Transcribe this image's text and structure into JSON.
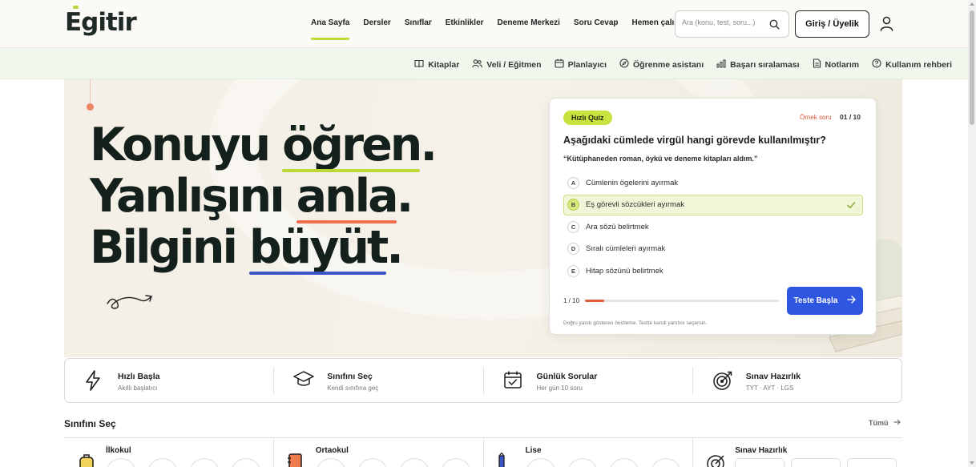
{
  "brand": {
    "name": "Egitir",
    "accent": "#bedc35"
  },
  "nav": {
    "items": [
      {
        "label": "Ana Sayfa",
        "active": true
      },
      {
        "label": "Dersler"
      },
      {
        "label": "Sınıflar"
      },
      {
        "label": "Etkinlikler"
      },
      {
        "label": "Deneme Merkezi"
      },
      {
        "label": "Soru Cevap"
      },
      {
        "label": "Hemen çalış"
      }
    ]
  },
  "search": {
    "placeholder": "Ara (konu, test, soru...)",
    "icon": "search-icon"
  },
  "auth": {
    "login_label": "Giriş / Üyelik",
    "user_icon": "user-icon"
  },
  "subnav": {
    "items": [
      {
        "label": "Kitaplar",
        "icon": "book-icon"
      },
      {
        "label": "Veli / Eğitmen",
        "icon": "users-icon"
      },
      {
        "label": "Planlayıcı",
        "icon": "calendar-icon"
      },
      {
        "label": "Öğrenme asistanı",
        "icon": "compass-icon"
      },
      {
        "label": "Başarı sıralaması",
        "icon": "bar-chart-icon"
      },
      {
        "label": "Notlarım",
        "icon": "note-icon"
      },
      {
        "label": "Kullanım rehberi",
        "icon": "help-icon"
      }
    ]
  },
  "hero": {
    "line1": {
      "prefix": "Konuyu ",
      "highlight": "öğren",
      "suffix": "."
    },
    "line2": {
      "prefix": "Yanlışını ",
      "highlight": "anla",
      "suffix": "."
    },
    "line3": {
      "prefix": "Bilgini ",
      "highlight": "büyüt",
      "suffix": "."
    },
    "underline_colors": [
      "#bcd838",
      "#ef6f4e",
      "#3b55c9"
    ]
  },
  "quiz": {
    "badge": "Hızlı Quiz",
    "example_label": "Örnek soru",
    "counter": "01 / 10",
    "question": "Aşağıdaki cümlede virgül hangi görevde kullanılmıştır?",
    "sentence": "“Kütüphaneden roman, öykü ve deneme kitapları aldım.”",
    "options": [
      {
        "letter": "A",
        "text": "Cümlenin ögelerini ayırmak"
      },
      {
        "letter": "B",
        "text": "Eş görevli sözcükleri ayırmak",
        "selected": true
      },
      {
        "letter": "C",
        "text": "Ara sözü belirtmek"
      },
      {
        "letter": "D",
        "text": "Sıralı cümleleri ayırmak"
      },
      {
        "letter": "E",
        "text": "Hitap sözünü belirtmek"
      }
    ],
    "progress_label": "1 / 10",
    "progress_fraction": 0.1,
    "start_label": "Teste Başla",
    "note": "Doğru yanıtı gösteren önizleme. Testte kendi yanıtını seçersin."
  },
  "features": [
    {
      "title": "Hızlı Başla",
      "sub": "Akıllı başlatıcı",
      "icon": "lightning-icon"
    },
    {
      "title": "Sınıfını Seç",
      "sub": "Kendi sınıfına geç",
      "icon": "graduation-cap-icon"
    },
    {
      "title": "Günlük Sorular",
      "sub": "Her gün 10 soru",
      "icon": "calendar-check-icon"
    },
    {
      "title": "Sınav Hazırlık",
      "sub": "TYT · AYT · LGS",
      "icon": "target-icon"
    }
  ],
  "levels_section": {
    "title": "Sınıfını Seç",
    "all_label": "Tümü",
    "levels": [
      {
        "name": "İlkokul",
        "icon": "backpack-icon"
      },
      {
        "name": "Ortaokul",
        "icon": "notebook-icon"
      },
      {
        "name": "Lise",
        "icon": "pencil-icon"
      },
      {
        "name": "Sınav Hazırlık",
        "icon": "target-icon"
      }
    ]
  }
}
